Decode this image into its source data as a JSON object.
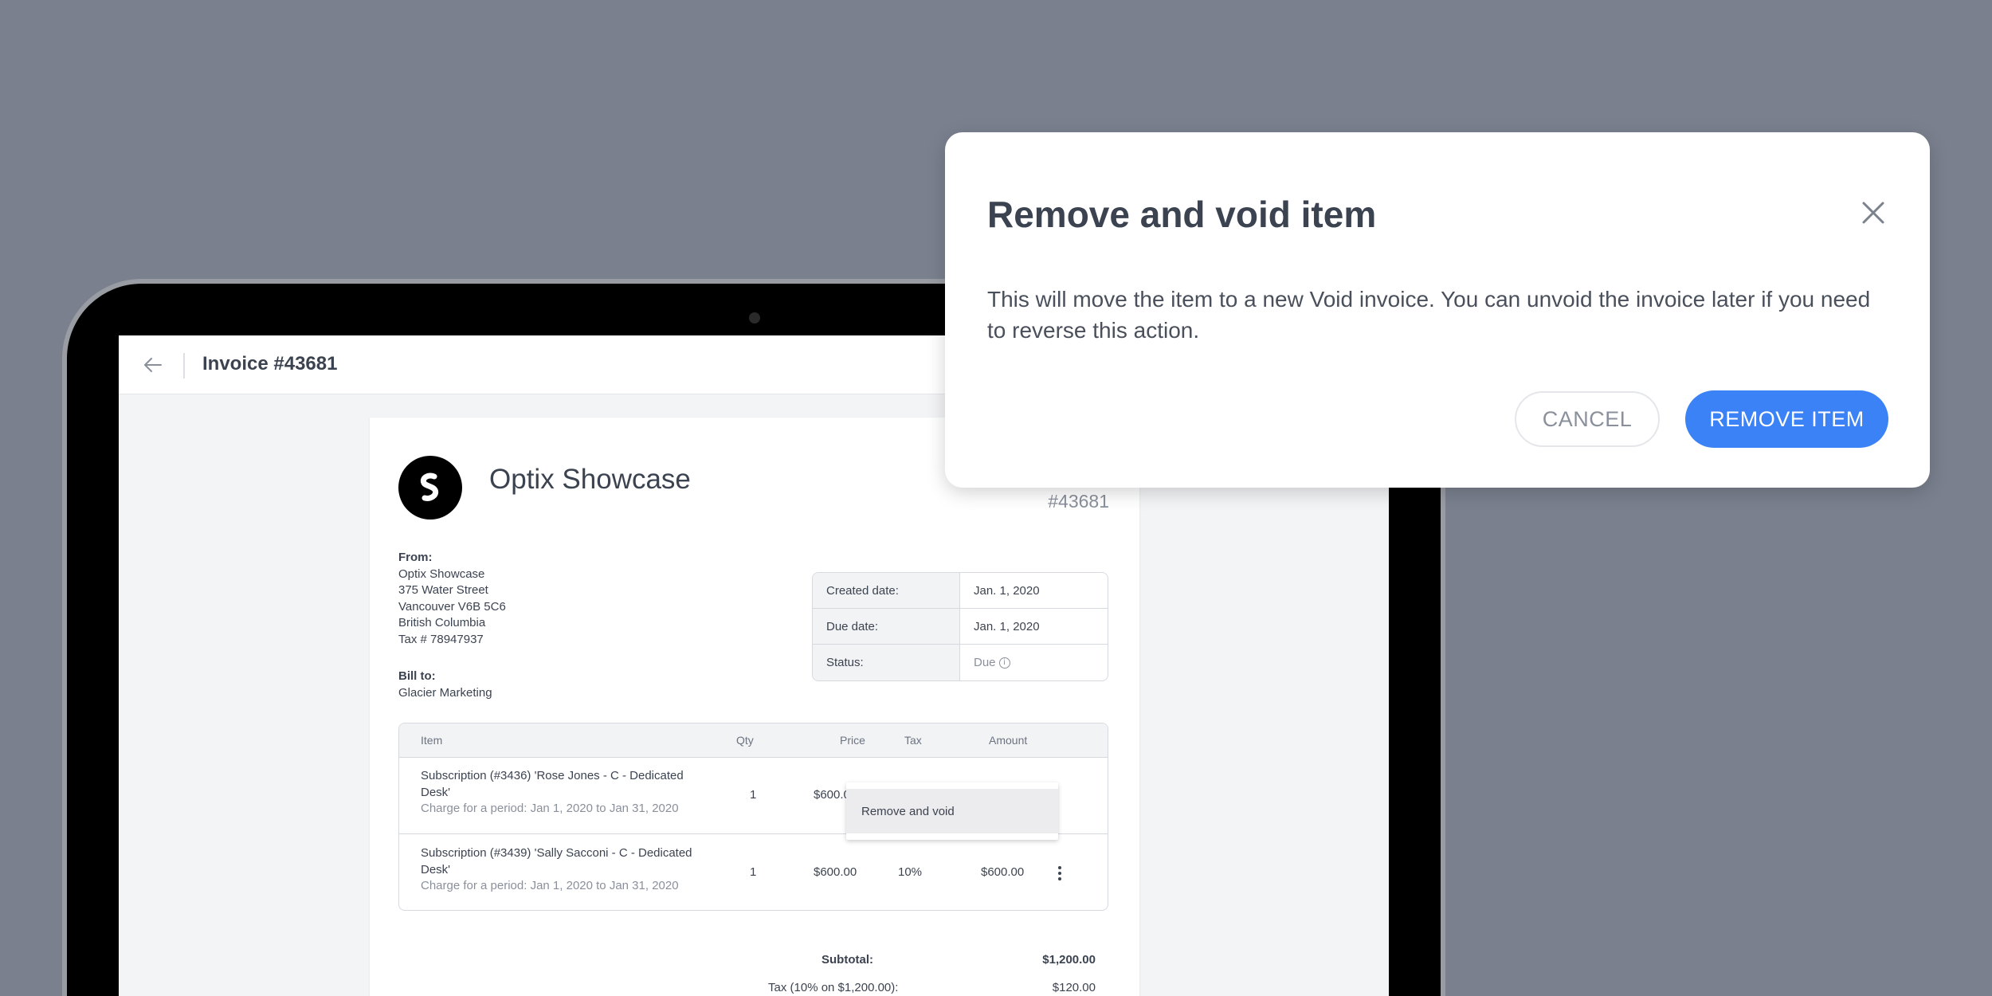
{
  "header": {
    "invoice_title": "Invoice #43681"
  },
  "invoice": {
    "company_name": "Optix Showcase",
    "number": "#43681",
    "from": {
      "label": "From:",
      "lines": [
        "Optix Showcase",
        "375 Water Street",
        "Vancouver V6B 5C6",
        "British Columbia",
        "Tax # 78947937"
      ]
    },
    "bill_to": {
      "label": "Bill to:",
      "name": "Glacier Marketing"
    },
    "meta": [
      {
        "key": "Created date:",
        "value": "Jan. 1, 2020"
      },
      {
        "key": "Due date:",
        "value": "Jan. 1, 2020"
      },
      {
        "key": "Status:",
        "value": "Due"
      }
    ],
    "columns": {
      "item": "Item",
      "qty": "Qty",
      "price": "Price",
      "tax": "Tax",
      "amount": "Amount"
    },
    "items": [
      {
        "title": "Subscription (#3436) 'Rose Jones - C - Dedicated Desk'",
        "period": "Charge for a period: Jan 1, 2020 to Jan 31, 2020",
        "qty": "1",
        "price": "$600.00",
        "tax": "",
        "amount": ""
      },
      {
        "title": "Subscription (#3439) 'Sally Sacconi - C - Dedicated Desk'",
        "period": "Charge for a period: Jan 1, 2020 to Jan 31, 2020",
        "qty": "1",
        "price": "$600.00",
        "tax": "10%",
        "amount": "$600.00"
      }
    ],
    "context_menu": {
      "item": "Remove and void"
    },
    "totals": {
      "subtotal_label": "Subtotal:",
      "subtotal_value": "$1,200.00",
      "tax_label": "Tax (10% on $1,200.00):",
      "tax_value": "$120.00"
    }
  },
  "modal": {
    "title": "Remove and void item",
    "body": "This will move the item to a new Void invoice. You can unvoid the invoice later if you need to reverse this action.",
    "cancel_label": "CANCEL",
    "confirm_label": "REMOVE ITEM"
  },
  "colors": {
    "background": "#7a808e",
    "primary": "#3b82f6",
    "text": "#3c4350",
    "muted": "#8a909b"
  },
  "icons": {
    "back": "arrow-left-icon",
    "close": "close-icon",
    "more": "kebab-menu-icon",
    "info": "info-icon",
    "logo": "optix-logo-icon"
  }
}
